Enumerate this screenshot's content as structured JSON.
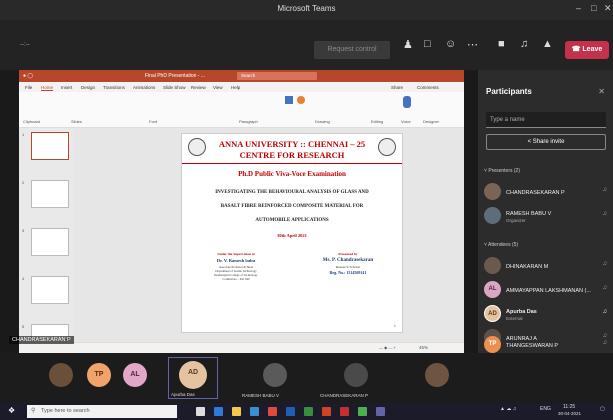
{
  "window": {
    "title": "Microsoft Teams",
    "minimize": "–",
    "maximize": "□",
    "close": "✕"
  },
  "callbar": {
    "timer": "--:--",
    "request_control": "Request control",
    "leave": "Leave"
  },
  "ppt": {
    "title": "Final PhD Presentation - ...",
    "search": "Search",
    "menu": [
      "File",
      "Home",
      "Insert",
      "Design",
      "Transitions",
      "Animations",
      "Slide Show",
      "Review",
      "View",
      "Help"
    ],
    "share": "Share",
    "comments": "Comments",
    "ribbon_groups": [
      "Clipboard",
      "Slides",
      "Font",
      "Paragraph",
      "Drawing",
      "Editing",
      "Voice",
      "Designer"
    ],
    "thumb_numbers": [
      "1",
      "2",
      "3",
      "4",
      "5"
    ],
    "status_zoom": "45%"
  },
  "slide": {
    "univ_line1": "ANNA UNIVERSITY :: CHENNAI – 25",
    "univ_line2": "CENTRE FOR RESEARCH",
    "exam": "Ph.D Public Viva-Voce Examination",
    "title_l1": "INVESTIGATING THE BEHAVIOURAL ANALYSIS OF GLASS AND",
    "title_l2": "BASALT FIBRE REINFORCED COMPOSITE MATERIAL FOR",
    "title_l3": "AUTOMOBILE APPLICATIONS",
    "date": "30th April 2021",
    "sup_head": "Under the Supervision of",
    "sup_name": "Dr. V. Ramesh babu",
    "sup_l1": "Associate Professor & Head",
    "sup_l2": "Department of Textile Technology",
    "sup_l3": "Kumaraguru College of Technology",
    "sup_l4": "Coimbatore – 641 049",
    "pres_head": "Presented by",
    "pres_name": "Ms. P. Chandrasekaran",
    "pres_role": "Research Scholar",
    "pres_reg": "Reg. No.: 1514569141",
    "page": "1"
  },
  "presenter_label": "CHANDRASEKARAN P",
  "participants": {
    "title": "Participants",
    "search_placeholder": "Type a name",
    "share_invite": "Share invite",
    "presenters_label": "Presenters (2)",
    "attendees_label": "Attendees (5)",
    "presenters": [
      {
        "name": "CHANDRASEKARAN P",
        "sub": "",
        "initials": ""
      },
      {
        "name": "RAMESH BABU V",
        "sub": "Organizer",
        "initials": ""
      }
    ],
    "attendees": [
      {
        "name": "DHINAKARAN M",
        "sub": "",
        "initials": ""
      },
      {
        "name": "AMMAYAPPAN LAKSHMANAN (...",
        "sub": "",
        "initials": "AL"
      },
      {
        "name": "Apurba Das",
        "sub": "External",
        "initials": "AD"
      },
      {
        "name": "ARUNRAJ A",
        "sub": "",
        "initials": ""
      },
      {
        "name": "THANGESWARAN P",
        "sub": "",
        "initials": "TP"
      }
    ]
  },
  "gallery": [
    {
      "label": "",
      "initials": ""
    },
    {
      "label": "",
      "initials": "TP"
    },
    {
      "label": "",
      "initials": "AL"
    },
    {
      "label": "Apurba Das",
      "initials": "AD"
    },
    {
      "label": "RAMESH BABU V",
      "initials": ""
    },
    {
      "label": "CHANDRASEKARAN P",
      "initials": ""
    },
    {
      "label": "",
      "initials": ""
    }
  ],
  "taskbar": {
    "search_placeholder": "Type here to search",
    "lang": "ENG",
    "time": "11:25",
    "date": "30-04-2021"
  },
  "colors": {
    "accent_ppt": "#b7472a",
    "leave": "#c4314b",
    "univ_red": "#c00000",
    "teams_bg": "#1f1f1f"
  }
}
